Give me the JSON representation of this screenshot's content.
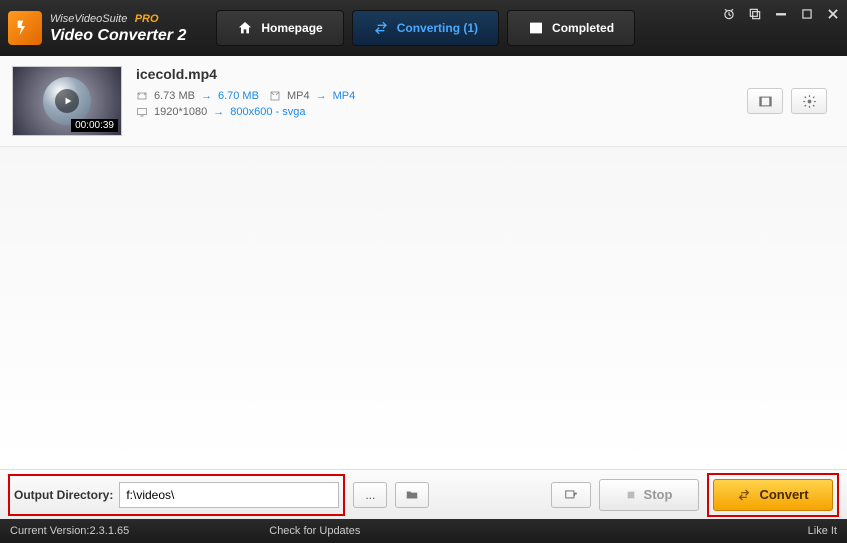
{
  "app": {
    "suite": "WiseVideoSuite",
    "name": "Video Converter 2",
    "badge": "PRO"
  },
  "tabs": {
    "home": "Homepage",
    "converting": "Converting (1)",
    "completed": "Completed"
  },
  "item": {
    "filename": "icecold.mp4",
    "duration": "00:00:39",
    "size_from": "6.73 MB",
    "size_to": "6.70 MB",
    "fmt_from": "MP4",
    "fmt_to": "MP4",
    "res_from": "1920*1080",
    "res_to": "800x600 - svga"
  },
  "output": {
    "label": "Output Directory:",
    "path": "f:\\videos\\",
    "browse": "..."
  },
  "actions": {
    "stop": "Stop",
    "convert": "Convert"
  },
  "status": {
    "version": "Current Version:2.3.1.65",
    "updates": "Check for Updates",
    "like": "Like It"
  }
}
